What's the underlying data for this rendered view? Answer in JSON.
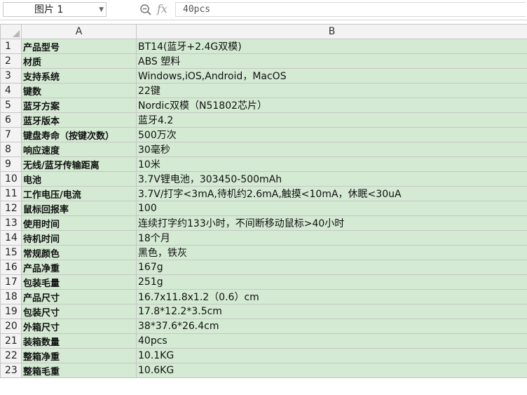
{
  "formula_bar": {
    "name_box": "图片 1",
    "fx_label": "fx",
    "formula_value": "40pcs"
  },
  "columns": [
    "A",
    "B"
  ],
  "rows": [
    {
      "num": "1",
      "a": "产品型号",
      "b": "BT14(蓝牙+2.4G双模)"
    },
    {
      "num": "2",
      "a": "材质",
      "b": "ABS 塑料"
    },
    {
      "num": "3",
      "a": "支持系统",
      "b": "Windows,iOS,Android，MacOS"
    },
    {
      "num": "4",
      "a": "键数",
      "b": "22键"
    },
    {
      "num": "5",
      "a": "蓝牙方案",
      "b": "Nordic双模（N51802芯片）"
    },
    {
      "num": "6",
      "a": "蓝牙版本",
      "b": "蓝牙4.2"
    },
    {
      "num": "7",
      "a": "键盘寿命（按键次数）",
      "b": "500万次"
    },
    {
      "num": "8",
      "a": "响应速度",
      "b": "30毫秒"
    },
    {
      "num": "9",
      "a": "无线/蓝牙传输距离",
      "b": "10米"
    },
    {
      "num": "10",
      "a": "电池",
      "b": "3.7V锂电池，303450-500mAh"
    },
    {
      "num": "11",
      "a": "工作电压/电流",
      "b": "3.7V/打字<3mA,待机约2.6mA,触摸<10mA，休眠<30uA"
    },
    {
      "num": "12",
      "a": "鼠标回报率",
      "b": "100"
    },
    {
      "num": "13",
      "a": "使用时间",
      "b": "连续打字约133小时，不间断移动鼠标>40小时"
    },
    {
      "num": "14",
      "a": "待机时间",
      "b": "18个月"
    },
    {
      "num": "15",
      "a": "常规颜色",
      "b": "黑色，铁灰"
    },
    {
      "num": "16",
      "a": "产品净重",
      "b": "167g"
    },
    {
      "num": "17",
      "a": "包装毛量",
      "b": "251g"
    },
    {
      "num": "18",
      "a": "产品尺寸",
      "b": "16.7x11.8x1.2（0.6）cm"
    },
    {
      "num": "19",
      "a": "包装尺寸",
      "b": "17.8*12.2*3.5cm"
    },
    {
      "num": "20",
      "a": "外箱尺寸",
      "b": "38*37.6*26.4cm"
    },
    {
      "num": "21",
      "a": "装箱数量",
      "b": "40pcs"
    },
    {
      "num": "22",
      "a": "整箱净重",
      "b": "10.1KG"
    },
    {
      "num": "23",
      "a": "整箱毛重",
      "b": "10.6KG"
    }
  ],
  "colors": {
    "cell_fill": "#d4ead3",
    "header_fill": "#f3f3f3",
    "grid": "#c6c6c6"
  }
}
